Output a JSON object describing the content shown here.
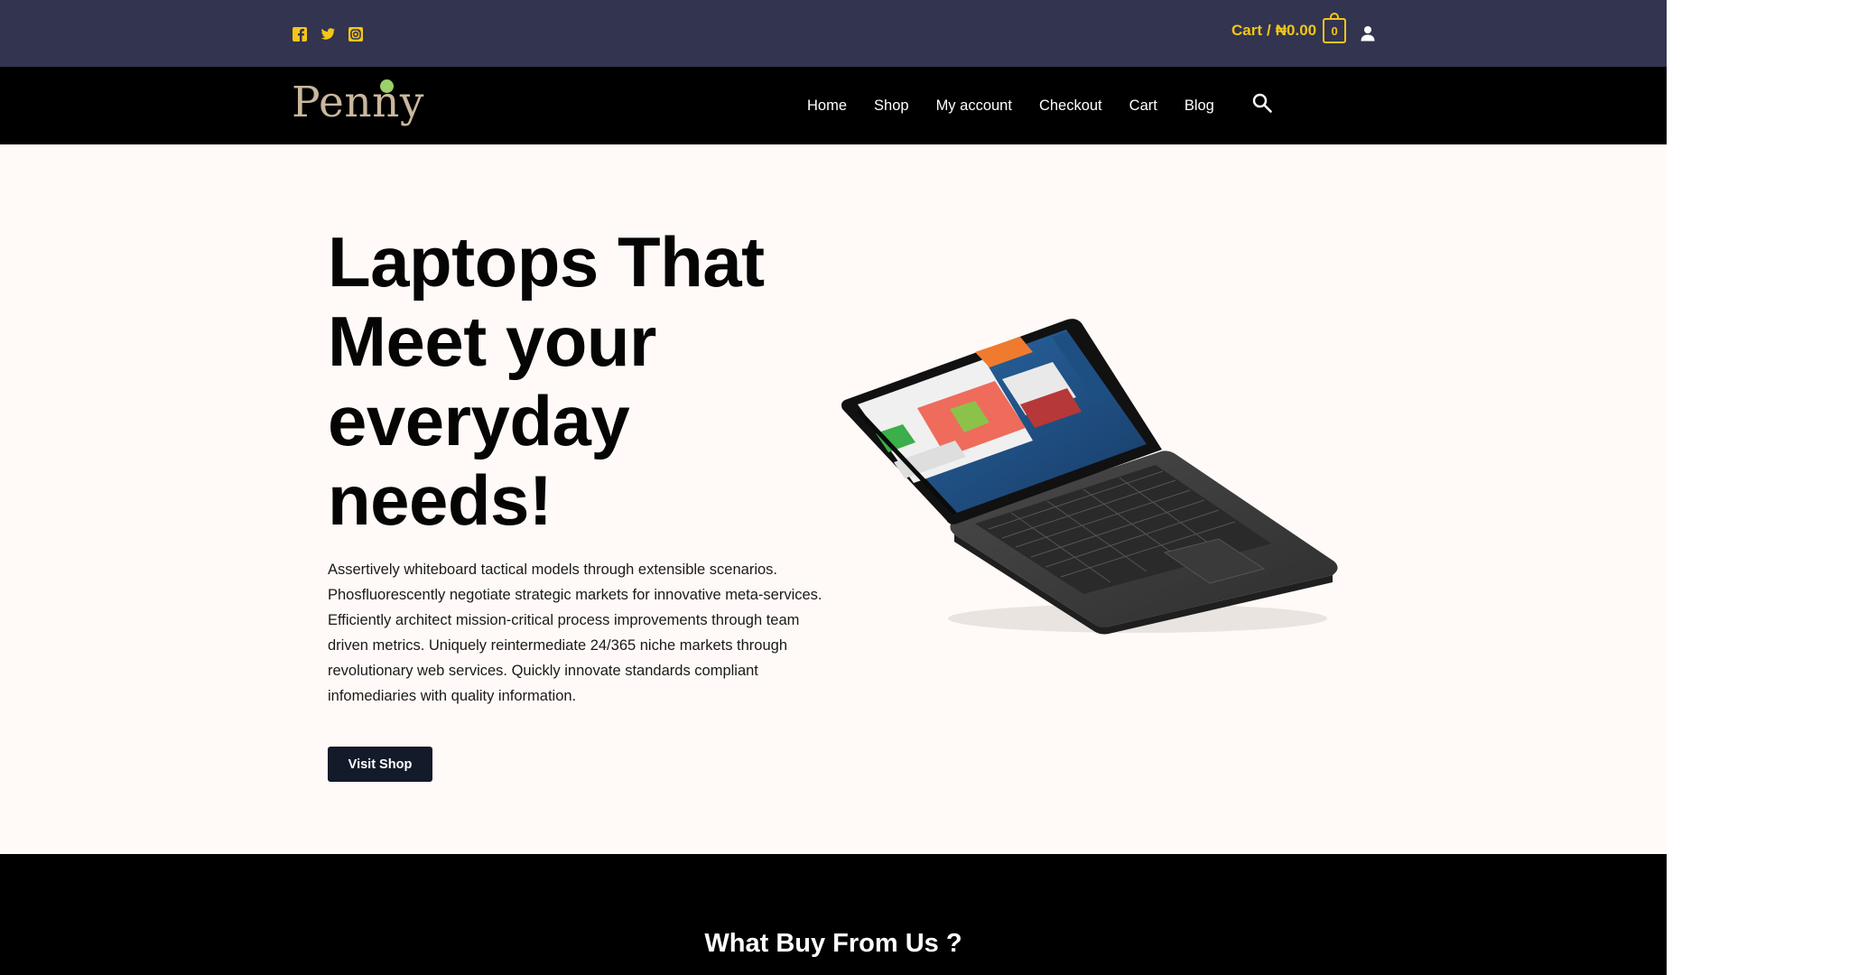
{
  "topbar": {
    "social": [
      {
        "icon": "facebook-icon",
        "color": "#f5c518"
      },
      {
        "icon": "twitter-icon",
        "color": "#f5c518"
      },
      {
        "icon": "instagram-icon",
        "color": "#f5c518"
      }
    ],
    "cart_label": "Cart",
    "cart_separator": "/",
    "cart_total": "₦0.00",
    "cart_count": "0",
    "accent_color": "#f5c518",
    "background": "#323450"
  },
  "header": {
    "logo_text": "Penny",
    "nav": [
      "Home",
      "Shop",
      "My account",
      "Checkout",
      "Cart",
      "Blog"
    ],
    "search_icon": "search-icon",
    "background": "#000000"
  },
  "hero": {
    "title": "Laptops That Meet your everyday needs!",
    "description": "Assertively whiteboard tactical models through extensible scenarios. Phosfluorescently negotiate strategic markets for innovative meta-services. Efficiently architect mission-critical process improvements through team driven metrics. Uniquely reintermediate 24/365 niche markets through revolutionary web services. Quickly innovate standards compliant infomediaries with quality information.",
    "button_label": "Visit Shop",
    "background": "#fffaf7"
  },
  "features": {
    "title": "What Buy From Us ?"
  }
}
